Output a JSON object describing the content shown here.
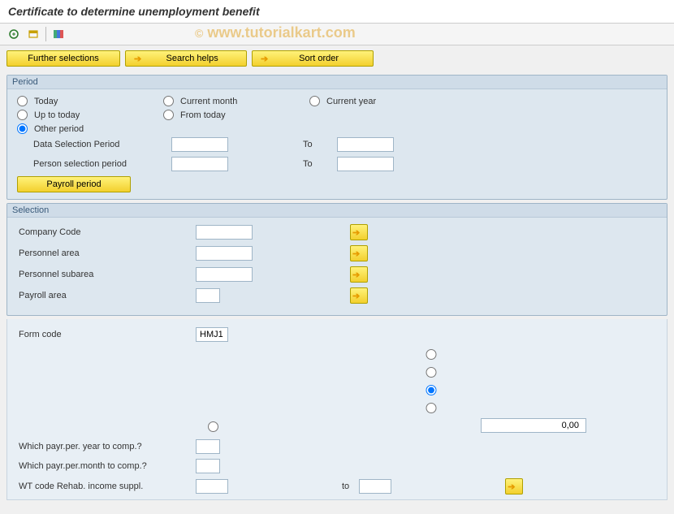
{
  "title": "Certificate to determine unemployment benefit",
  "watermark": "www.tutorialkart.com",
  "toolbar_buttons": {
    "further_selections": "Further selections",
    "search_helps": "Search helps",
    "sort_order": "Sort order"
  },
  "period_panel": {
    "title": "Period",
    "radios": {
      "today": "Today",
      "current_month": "Current month",
      "current_year": "Current year",
      "up_to_today": "Up to today",
      "from_today": "From today",
      "other_period": "Other period"
    },
    "selected": "other_period",
    "data_selection_label": "Data Selection Period",
    "person_selection_label": "Person selection period",
    "to_label": "To",
    "payroll_period_btn": "Payroll period"
  },
  "selection_panel": {
    "title": "Selection",
    "rows": [
      {
        "label": "Company Code",
        "value": ""
      },
      {
        "label": "Personnel area",
        "value": ""
      },
      {
        "label": "Personnel subarea",
        "value": ""
      },
      {
        "label": "Payroll area",
        "value": ""
      }
    ]
  },
  "form": {
    "form_code_label": "Form code",
    "form_code_value": "HMJ1",
    "radio_selected_index": 2,
    "numeric_value": "0,00",
    "payr_year_label": "Which payr.per. year to comp.?",
    "payr_month_label": "Which payr.per.month to comp.?",
    "wt_code_label": "WT code Rehab. income suppl.",
    "to_label": "to"
  }
}
